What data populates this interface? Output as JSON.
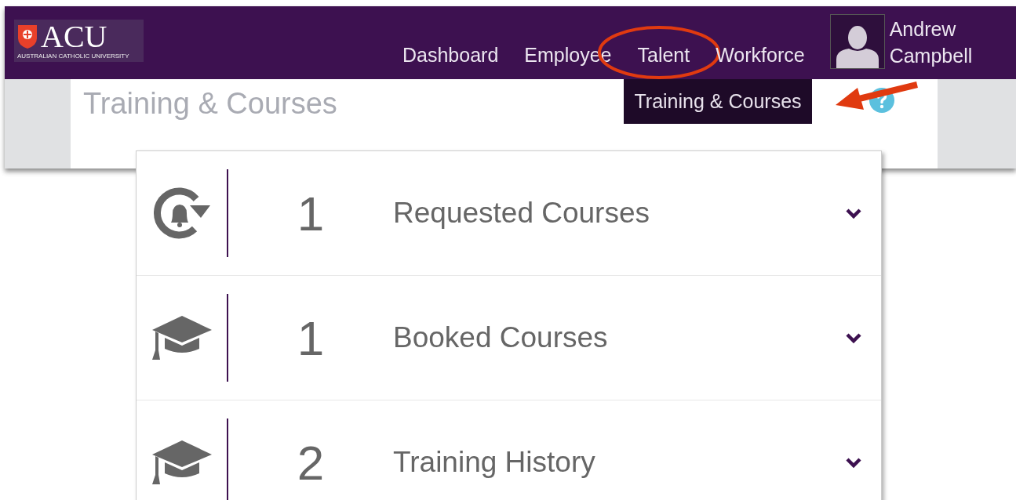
{
  "logo": {
    "name": "ACU",
    "tagline": "AUSTRALIAN CATHOLIC UNIVERSITY"
  },
  "nav": [
    {
      "label": "Dashboard",
      "expanded": false
    },
    {
      "label": "Employee",
      "expanded": false
    },
    {
      "label": "Talent",
      "expanded": true,
      "menu": [
        "Training & Courses"
      ]
    },
    {
      "label": "Workforce",
      "expanded": false
    }
  ],
  "user": {
    "name": "Andrew Campbell"
  },
  "page_title": "Training & Courses",
  "sections": [
    {
      "kind": "requested",
      "count": "1",
      "title": "Requested Courses",
      "expanded": false
    },
    {
      "kind": "booked",
      "count": "1",
      "title": "Booked Courses",
      "expanded": false
    },
    {
      "kind": "history",
      "count": "2",
      "title": "Training History",
      "expanded": false
    }
  ]
}
